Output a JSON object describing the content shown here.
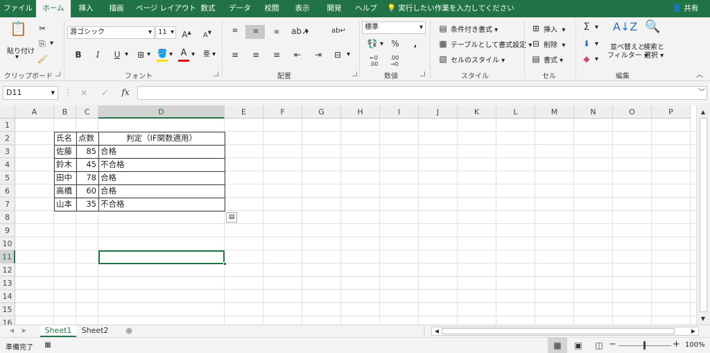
{
  "tabs": [
    "ファイル",
    "ホーム",
    "挿入",
    "描画",
    "ページ レイアウト",
    "数式",
    "データ",
    "校閲",
    "表示",
    "開発",
    "ヘルプ"
  ],
  "active_tab": "ホーム",
  "tell_me": "実行したい作業を入力してください",
  "share": "共有",
  "ribbon": {
    "clipboard": {
      "paste": "貼り付け",
      "label": "クリップボード"
    },
    "font": {
      "name": "游ゴシック",
      "size": "11",
      "bold": "B",
      "italic": "I",
      "underline": "U",
      "label": "フォント"
    },
    "alignment": {
      "label": "配置"
    },
    "number": {
      "format": "標準",
      "percent": "%",
      "comma": ",",
      "label": "数値"
    },
    "styles": {
      "conditional": "条件付き書式",
      "table": "テーブルとして書式設定",
      "cell_styles": "セルのスタイル",
      "label": "スタイル"
    },
    "cells": {
      "insert": "挿入",
      "delete": "削除",
      "format": "書式",
      "label": "セル"
    },
    "editing": {
      "sort": "並べ替えと",
      "sort2": "フィルター",
      "find": "検索と",
      "find2": "選択",
      "label": "編集"
    }
  },
  "namebox": "D11",
  "fx": "fx",
  "columns": [
    "A",
    "B",
    "C",
    "D",
    "E",
    "F",
    "G",
    "H",
    "I",
    "J",
    "K",
    "L",
    "M",
    "N",
    "O",
    "P"
  ],
  "rows": [
    "1",
    "2",
    "3",
    "4",
    "5",
    "6",
    "7",
    "8",
    "9",
    "10",
    "11",
    "12",
    "13",
    "14",
    "15",
    "16"
  ],
  "table": {
    "headers": [
      "氏名",
      "点数",
      "判定（IF関数適用）"
    ],
    "rows": [
      [
        "佐藤",
        "85",
        "合格"
      ],
      [
        "鈴木",
        "45",
        "不合格"
      ],
      [
        "田中",
        "78",
        "合格"
      ],
      [
        "高橋",
        "60",
        "合格"
      ],
      [
        "山本",
        "35",
        "不合格"
      ]
    ]
  },
  "sheets": [
    "Sheet1",
    "Sheet2"
  ],
  "active_sheet": "Sheet1",
  "status": "準備完了",
  "zoom": "100%"
}
